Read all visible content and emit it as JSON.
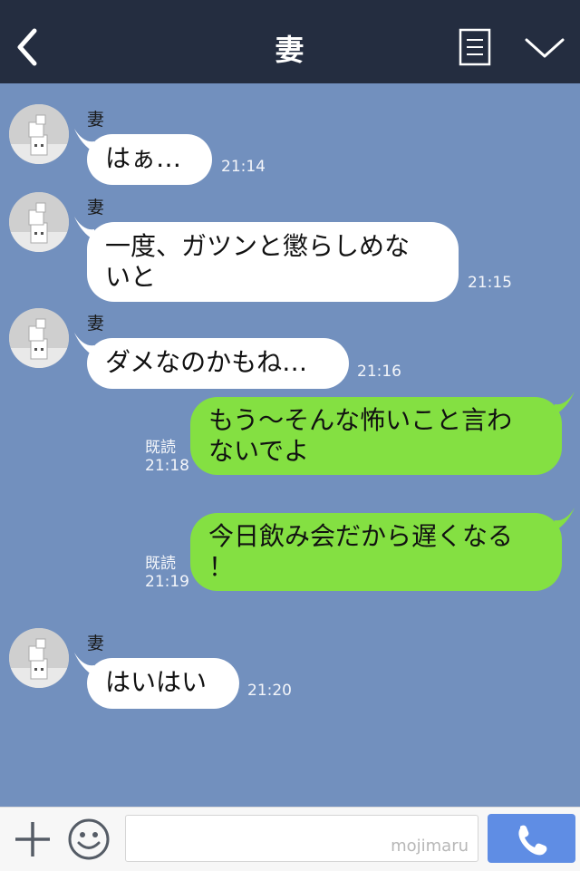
{
  "header": {
    "title": "妻"
  },
  "messages": [
    {
      "sender": "妻",
      "text": "はぁ…",
      "time": "21:14"
    },
    {
      "sender": "妻",
      "text": "一度、ガツンと懲らしめな\nいと",
      "time": "21:15"
    },
    {
      "sender": "妻",
      "text": "ダメなのかもね…",
      "time": "21:16"
    },
    {
      "read": "既読",
      "time": "21:18",
      "text": "もう～そんな怖いこと言わ\nないでよ"
    },
    {
      "read": "既読",
      "time": "21:19",
      "text": "今日飲み会だから遅くなる\n！"
    },
    {
      "sender": "妻",
      "text": "はいはい",
      "time": "21:20"
    }
  ],
  "footer": {
    "watermark": "mojimaru"
  },
  "colors": {
    "header_bg": "#242d40",
    "chat_bg": "#7290be",
    "incoming": "#ffffff",
    "outgoing": "#84e042",
    "call": "#5f8de4"
  },
  "icons": [
    "back-arrow-icon",
    "menu-icon",
    "chevron-down-icon",
    "plus-icon",
    "smiley-icon",
    "phone-icon",
    "avatar-image"
  ]
}
